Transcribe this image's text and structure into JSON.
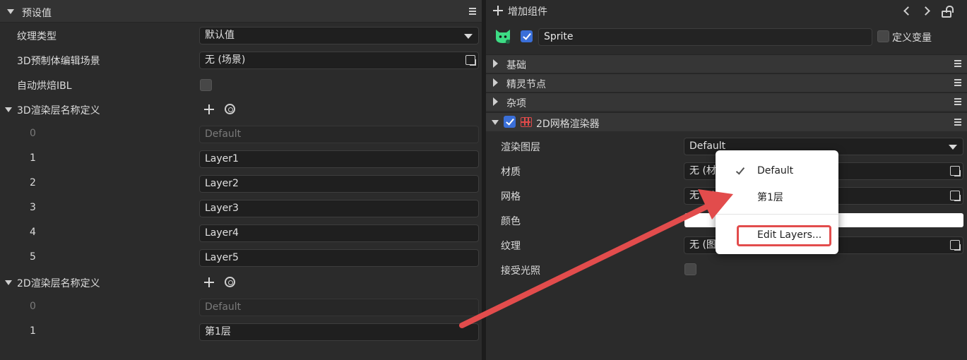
{
  "left": {
    "header": {
      "title": "预设值"
    },
    "rows": {
      "texture_type": {
        "label": "纹理类型",
        "value": "默认值"
      },
      "prefab_scene": {
        "label": "3D预制体编辑场景",
        "value": "无 (场景)"
      },
      "auto_bake": {
        "label": "自动烘焙IBL",
        "checked": false
      }
    },
    "layers3d": {
      "title": "3D渲染层名称定义",
      "items": [
        {
          "index": "0",
          "value": "Default"
        },
        {
          "index": "1",
          "value": "Layer1"
        },
        {
          "index": "2",
          "value": "Layer2"
        },
        {
          "index": "3",
          "value": "Layer3"
        },
        {
          "index": "4",
          "value": "Layer4"
        },
        {
          "index": "5",
          "value": "Layer5"
        }
      ]
    },
    "layers2d": {
      "title": "2D渲染层名称定义",
      "items": [
        {
          "index": "0",
          "value": "Default"
        },
        {
          "index": "1",
          "value": "第1层"
        }
      ]
    }
  },
  "right": {
    "topbar": {
      "add_component": "增加组件"
    },
    "node": {
      "name": "Sprite",
      "define_var": "定义变量",
      "enabled": true
    },
    "sections": {
      "basic": "基础",
      "sprite_node": "精灵节点",
      "misc": "杂项",
      "mesh_renderer": "2D网格渲染器"
    },
    "props": {
      "render_layer": {
        "label": "渲染图层",
        "value": "Default"
      },
      "material": {
        "label": "材质",
        "value": "无 (材"
      },
      "mesh": {
        "label": "网格",
        "value": "无 (M"
      },
      "color": {
        "label": "颜色"
      },
      "texture": {
        "label": "纹理",
        "value": "无 (图"
      },
      "receive_light": {
        "label": "接受光照",
        "checked": false
      }
    }
  },
  "popup": {
    "items": [
      "Default",
      "第1层"
    ],
    "selected": "Default",
    "edit_layers": "Edit Layers..."
  },
  "colors": {
    "accent_blue": "#3a6fd8",
    "annotation_red": "#e24c4c",
    "sprite_green": "#3ddc84"
  }
}
